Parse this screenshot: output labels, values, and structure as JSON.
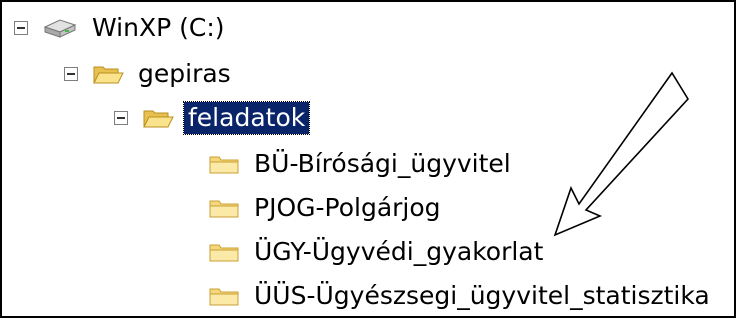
{
  "tree": {
    "drive": {
      "label": "WinXP (C:)",
      "icon": "hard-drive-icon"
    },
    "folder_gepiras": {
      "label": "gepiras",
      "icon": "folder-open-icon"
    },
    "folder_feladatok": {
      "label": "feladatok",
      "icon": "folder-open-icon",
      "selected": true
    },
    "subfolders": [
      {
        "label": "BÜ-Bírósági_ügyvitel",
        "icon": "folder-icon"
      },
      {
        "label": "PJOG-Polgárjog",
        "icon": "folder-icon"
      },
      {
        "label": "ÜGY-Ügyvédi_gyakorlat",
        "icon": "folder-icon"
      },
      {
        "label": "ÜÜS-Ügyészsegi_ügyvitel_statisztika",
        "icon": "folder-icon"
      }
    ]
  },
  "annotation": {
    "icon": "arrow-pointer-icon"
  },
  "colors": {
    "selection": "#0a246a",
    "folder_fill": "#f5d67a",
    "folder_edge": "#c9a032"
  }
}
